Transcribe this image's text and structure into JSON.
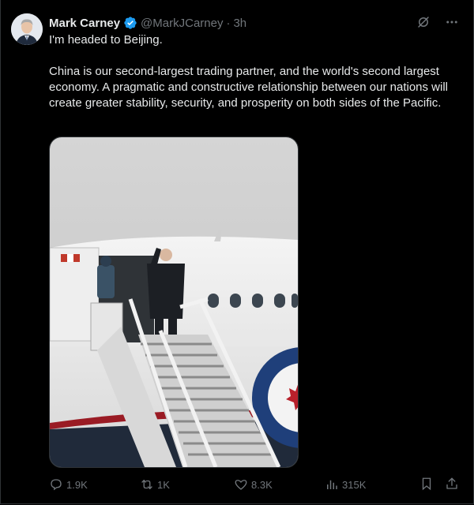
{
  "author": {
    "name": "Mark Carney",
    "handle": "@MarkJCarney",
    "separator": "·",
    "time": "3h",
    "verified_color": "#1d9bf0"
  },
  "tweet": {
    "line1": "I'm headed to Beijing.",
    "paragraph2": "China is our second-largest trading partner, and the world's second largest economy. A pragmatic and constructive relationship between our nations will create greater stability, security, and prosperity on both sides of the Pacific."
  },
  "actions": {
    "replies": "1.9K",
    "reposts": "1K",
    "likes": "8.3K",
    "views": "315K"
  },
  "colors": {
    "background": "#000000",
    "text": "#e7e9ea",
    "secondary": "#71767b",
    "border": "#2f3336"
  }
}
